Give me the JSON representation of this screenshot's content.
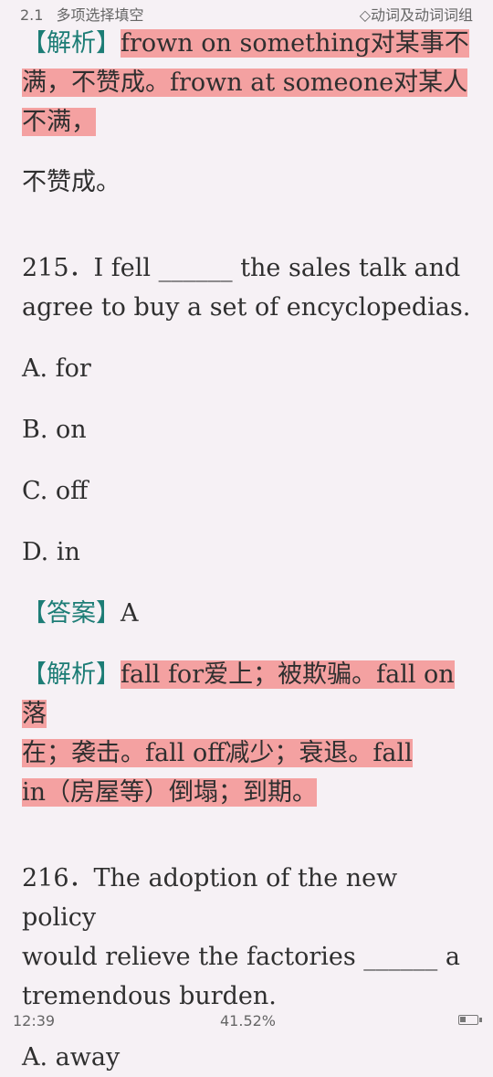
{
  "header": {
    "section_no": "2.1",
    "section_title": "多项选择填空",
    "chapter_title": "◇动词及动词词组"
  },
  "q214_tail": {
    "tag": "【解析】",
    "line1": "frown on something对某事不",
    "line2": "满，不赞成。frown at someone对某人",
    "line3": "不满，",
    "line4": "不赞成。"
  },
  "q215": {
    "stem_line1": "215．I fell ______ the sales talk and",
    "stem_line2": "agree to buy a set of encyclopedias.",
    "options": [
      "A. for",
      "B. on",
      "C. off",
      "D. in"
    ],
    "answer_tag": "【答案】",
    "answer": "A",
    "analysis_tag": "【解析】",
    "analysis_line1": "fall for爱上；被欺骗。fall on落",
    "analysis_line2": "在；袭击。fall off减少；衰退。fall",
    "analysis_line3": "in（房屋等）倒塌；到期。"
  },
  "q216": {
    "stem_line1": "216．The adoption of the new policy",
    "stem_line2": "would relieve the factories ______ a",
    "stem_line3": "tremendous burden.",
    "option_a": "A. away"
  },
  "status": {
    "time": "12:39",
    "progress": "41.52%",
    "battery_icon": "battery-icon"
  }
}
